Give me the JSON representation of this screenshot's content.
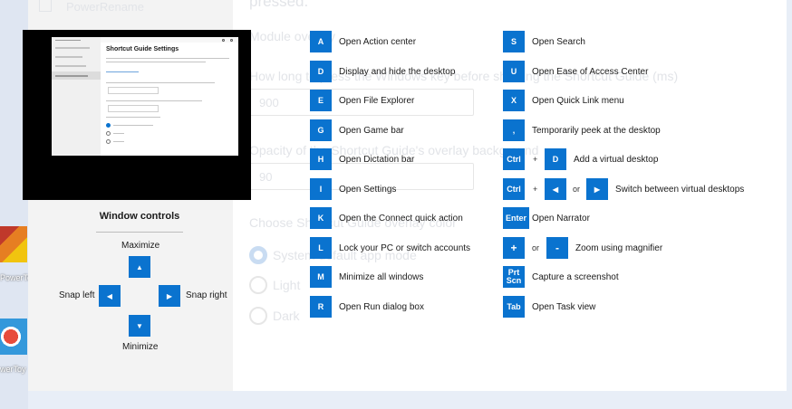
{
  "background": {
    "desktop_label_1": "PowerTo",
    "desktop_label_2": "werToy",
    "settings": {
      "nav_item": "PowerRename",
      "heading": "pressed.",
      "field_module": "Module overlay",
      "field_press_label": "How long to press the Windows key before showing the Shortcut Guide (ms)",
      "field_press_value": "900",
      "field_opacity_label": "Opacity of the Shortcut Guide's overlay background",
      "field_opacity_value": "90",
      "theme_label": "Choose Shortcut Guide overlay color",
      "theme_options": [
        "System default app mode",
        "Light",
        "Dark"
      ]
    }
  },
  "thumbnail": {
    "window_title": "PowerToys Settings",
    "page_title": "Shortcut Guide Settings"
  },
  "window_controls": {
    "title": "Window controls",
    "maximize": "Maximize",
    "minimize": "Minimize",
    "snap_left": "Snap left",
    "snap_right": "Snap right",
    "up_arrow": "▲",
    "down_arrow": "▼",
    "left_arrow": "◀",
    "right_arrow": "▶"
  },
  "shortcuts_left": [
    {
      "key": "A",
      "desc": "Open Action center"
    },
    {
      "key": "D",
      "desc": "Display and hide the desktop"
    },
    {
      "key": "E",
      "desc": "Open File Explorer"
    },
    {
      "key": "G",
      "desc": "Open Game bar"
    },
    {
      "key": "H",
      "desc": "Open Dictation bar"
    },
    {
      "key": "I",
      "desc": "Open Settings"
    },
    {
      "key": "K",
      "desc": "Open the Connect quick action"
    },
    {
      "key": "L",
      "desc": "Lock your PC or switch accounts"
    },
    {
      "key": "M",
      "desc": "Minimize all windows"
    },
    {
      "key": "R",
      "desc": "Open Run dialog box"
    }
  ],
  "shortcuts_right": {
    "s": {
      "key": "S",
      "desc": "Open Search"
    },
    "u": {
      "key": "U",
      "desc": "Open Ease of Access Center"
    },
    "x": {
      "key": "X",
      "desc": "Open Quick Link menu"
    },
    "comma": {
      "key": ",",
      "desc": "Temporarily peek at the desktop"
    },
    "ctrl_d": {
      "key1": "Ctrl",
      "plus": "+",
      "key2": "D",
      "desc": "Add a virtual desktop"
    },
    "ctrl_arrows": {
      "key1": "Ctrl",
      "plus": "+",
      "key2": "◀",
      "or": "or",
      "key3": "▶",
      "desc": "Switch between virtual desktops"
    },
    "enter": {
      "key": "Enter",
      "desc": "Open Narrator"
    },
    "zoom": {
      "key1": "+",
      "or": "or",
      "key2": "-",
      "desc": "Zoom using magnifier"
    },
    "prtscn": {
      "key_line1": "Prt",
      "key_line2": "Scn",
      "desc": "Capture a screenshot"
    },
    "tab": {
      "key": "Tab",
      "desc": "Open Task view"
    }
  }
}
